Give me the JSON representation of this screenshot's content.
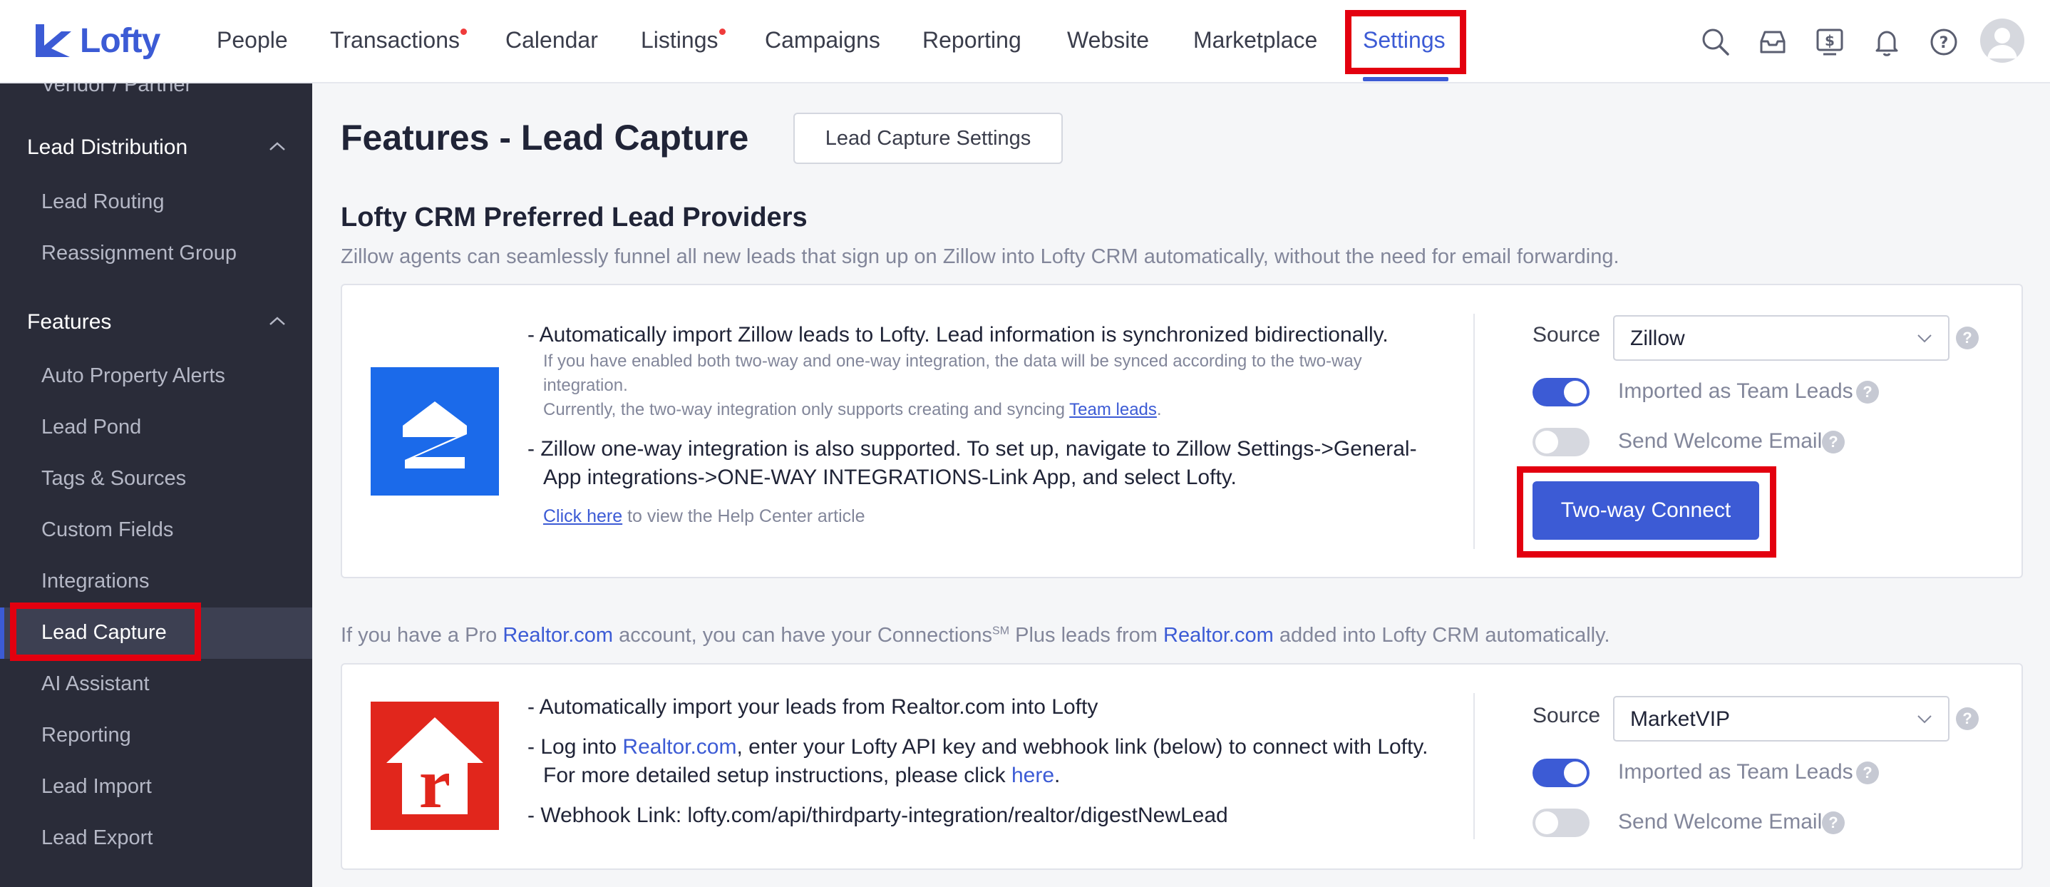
{
  "brand": {
    "name": "Lofty",
    "accent": "#3c5bd5"
  },
  "nav": {
    "items": [
      "People",
      "Transactions",
      "Calendar",
      "Listings",
      "Campaigns",
      "Reporting",
      "Website",
      "Marketplace",
      "Settings"
    ],
    "active": "Settings",
    "icons": [
      "search-icon",
      "inbox-icon",
      "billing-icon",
      "bell-icon",
      "help-icon",
      "avatar"
    ]
  },
  "sidebar": {
    "cut_item": "Vendor / Partner",
    "groups": [
      {
        "label": "Lead Distribution",
        "items": [
          "Lead Routing",
          "Reassignment Group"
        ]
      },
      {
        "label": "Features",
        "items": [
          "Auto Property Alerts",
          "Lead Pond",
          "Tags & Sources",
          "Custom Fields",
          "Integrations",
          "Lead Capture",
          "AI Assistant",
          "Reporting",
          "Lead Import",
          "Lead Export"
        ]
      }
    ],
    "active_item": "Lead Capture"
  },
  "main": {
    "title": "Features - Lead Capture",
    "settings_button": "Lead Capture Settings",
    "section_title": "Lofty CRM Preferred Lead Providers",
    "section_desc": "Zillow agents can seamlessly funnel all new leads that sign up on Zillow into Lofty CRM automatically, without the need for email forwarding.",
    "zillow": {
      "bullet1": "- Automatically import Zillow leads to Lofty. Lead information is synchronized bidirectionally.",
      "note1a": "If you have enabled both two-way and one-way integration, the data will be synced according to the two-way",
      "note1b": "integration.",
      "note2_pre": "Currently, the two-way integration only supports creating and syncing ",
      "note2_link": "Team leads",
      "note2_post": ".",
      "bullet2a": "- Zillow one-way integration is also supported. To set up, navigate to Zillow Settings->General-",
      "bullet2b": "App integrations->ONE-WAY INTEGRATIONS-Link App, and select Lofty.",
      "help_link": "Click here",
      "help_text": " to view the Help Center article",
      "source_label": "Source",
      "source_value": "Zillow",
      "toggle1_label": "Imported as Team Leads",
      "toggle1_on": true,
      "toggle2_label": "Send Welcome Email",
      "toggle2_on": false,
      "connect_button": "Two-way Connect"
    },
    "realtor": {
      "desc_pre": "If you have a Pro ",
      "desc_link1": "Realtor.com",
      "desc_mid": " account, you can have your Connections",
      "desc_sup": "SM",
      "desc_mid2": " Plus leads from ",
      "desc_link2": "Realtor.com",
      "desc_post": " added into Lofty CRM automatically.",
      "bullet1": "- Automatically import your leads from Realtor.com into Lofty",
      "bullet2_pre": "- Log into ",
      "bullet2_link": "Realtor.com",
      "bullet2_post": ", enter your Lofty API key and webhook link (below) to connect with Lofty.",
      "bullet2b_pre": "For more detailed setup instructions, please click ",
      "bullet2b_link": "here",
      "bullet2b_post": ".",
      "bullet3": "- Webhook Link: lofty.com/api/thirdparty-integration/realtor/digestNewLead",
      "source_label": "Source",
      "source_value": "MarketVIP",
      "toggle1_label": "Imported as Team Leads",
      "toggle1_on": true,
      "toggle2_label": "Send Welcome Email",
      "toggle2_on": false
    }
  }
}
